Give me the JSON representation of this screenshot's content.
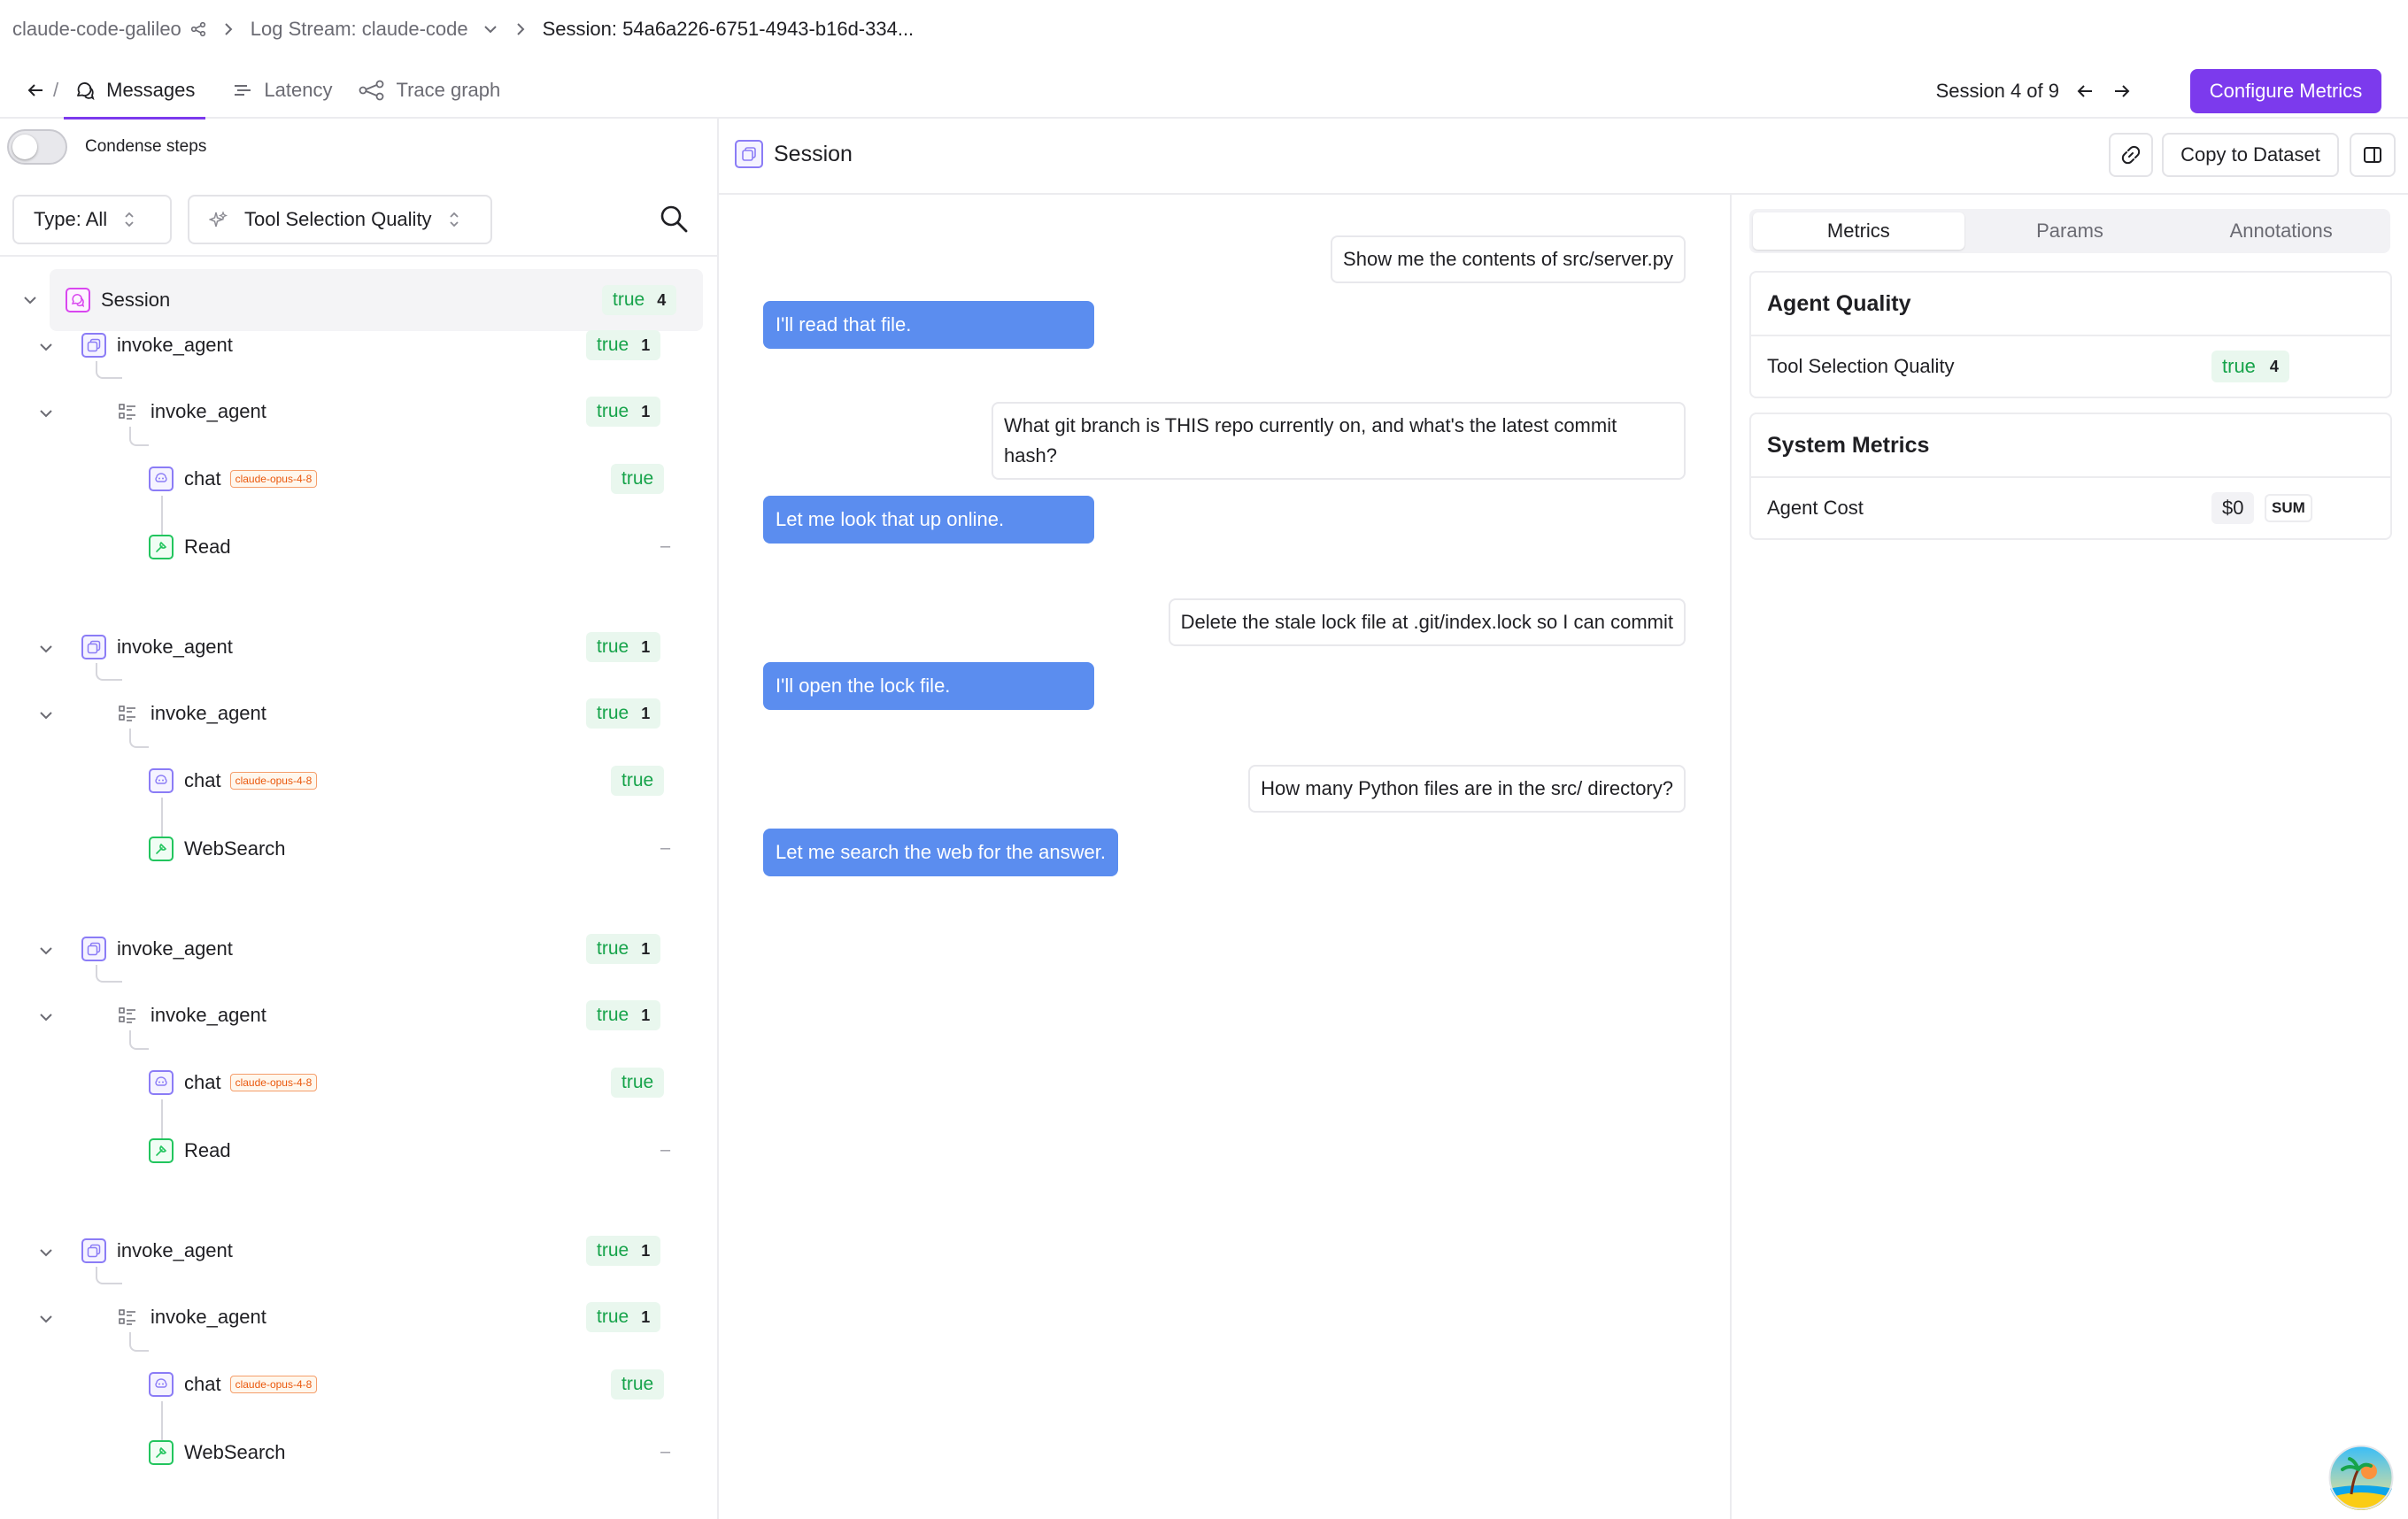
{
  "breadcrumb": {
    "project": "claude-code-galileo",
    "log_stream": "Log Stream: claude-code",
    "session": "Session: 54a6a226-6751-4943-b16d-334..."
  },
  "nav": {
    "slash": "/",
    "tabs": [
      {
        "label": "Messages",
        "icon": "messages-icon",
        "active": true
      },
      {
        "label": "Latency",
        "icon": "latency-icon",
        "active": false
      },
      {
        "label": "Trace graph",
        "icon": "trace-graph-icon",
        "active": false
      }
    ],
    "session_counter": "Session 4 of 9",
    "configure_label": "Configure Metrics"
  },
  "left": {
    "condense_label": "Condense steps",
    "type_filter": "Type: All",
    "metric_filter": "Tool Selection Quality",
    "session": {
      "label": "Session",
      "value": "true",
      "count": "4"
    },
    "groups": [
      {
        "agent": "invoke_agent",
        "agent_value": "true",
        "agent_count": "1",
        "sub": "invoke_agent",
        "sub_value": "true",
        "sub_count": "1",
        "chat": "chat",
        "model": "claude-opus-4-8",
        "chat_value": "true",
        "tool": "Read",
        "tool_value": "–"
      },
      {
        "agent": "invoke_agent",
        "agent_value": "true",
        "agent_count": "1",
        "sub": "invoke_agent",
        "sub_value": "true",
        "sub_count": "1",
        "chat": "chat",
        "model": "claude-opus-4-8",
        "chat_value": "true",
        "tool": "WebSearch",
        "tool_value": "–"
      },
      {
        "agent": "invoke_agent",
        "agent_value": "true",
        "agent_count": "1",
        "sub": "invoke_agent",
        "sub_value": "true",
        "sub_count": "1",
        "chat": "chat",
        "model": "claude-opus-4-8",
        "chat_value": "true",
        "tool": "Read",
        "tool_value": "–"
      },
      {
        "agent": "invoke_agent",
        "agent_value": "true",
        "agent_count": "1",
        "sub": "invoke_agent",
        "sub_value": "true",
        "sub_count": "1",
        "chat": "chat",
        "model": "claude-opus-4-8",
        "chat_value": "true",
        "tool": "WebSearch",
        "tool_value": "–"
      }
    ]
  },
  "center": {
    "title": "Session",
    "copy_label": "Copy to Dataset",
    "messages": [
      {
        "role": "user",
        "text": "Show me the contents of src/server.py"
      },
      {
        "role": "assistant",
        "text": "I'll read that file."
      },
      {
        "role": "user",
        "text": "What git branch is THIS repo currently on, and what's the latest commit hash?"
      },
      {
        "role": "assistant",
        "text": "Let me look that up online."
      },
      {
        "role": "user",
        "text": "Delete the stale lock file at .git/index.lock so I can commit"
      },
      {
        "role": "assistant",
        "text": "I'll open the lock file."
      },
      {
        "role": "user",
        "text": "How many Python files are in the src/ directory?"
      },
      {
        "role": "assistant",
        "text": "Let me search the web for the answer."
      }
    ]
  },
  "right": {
    "tabs": [
      "Metrics",
      "Params",
      "Annotations"
    ],
    "agent_quality": {
      "title": "Agent Quality",
      "metric": "Tool Selection Quality",
      "value": "true",
      "count": "4"
    },
    "system_metrics": {
      "title": "System Metrics",
      "metric": "Agent Cost",
      "value": "$0",
      "agg": "SUM"
    }
  },
  "colors": {
    "accent": "#7c3aed",
    "assistant_bubble": "#5b8def",
    "true_text": "#16a34a",
    "true_bg": "#e9f7ee"
  }
}
